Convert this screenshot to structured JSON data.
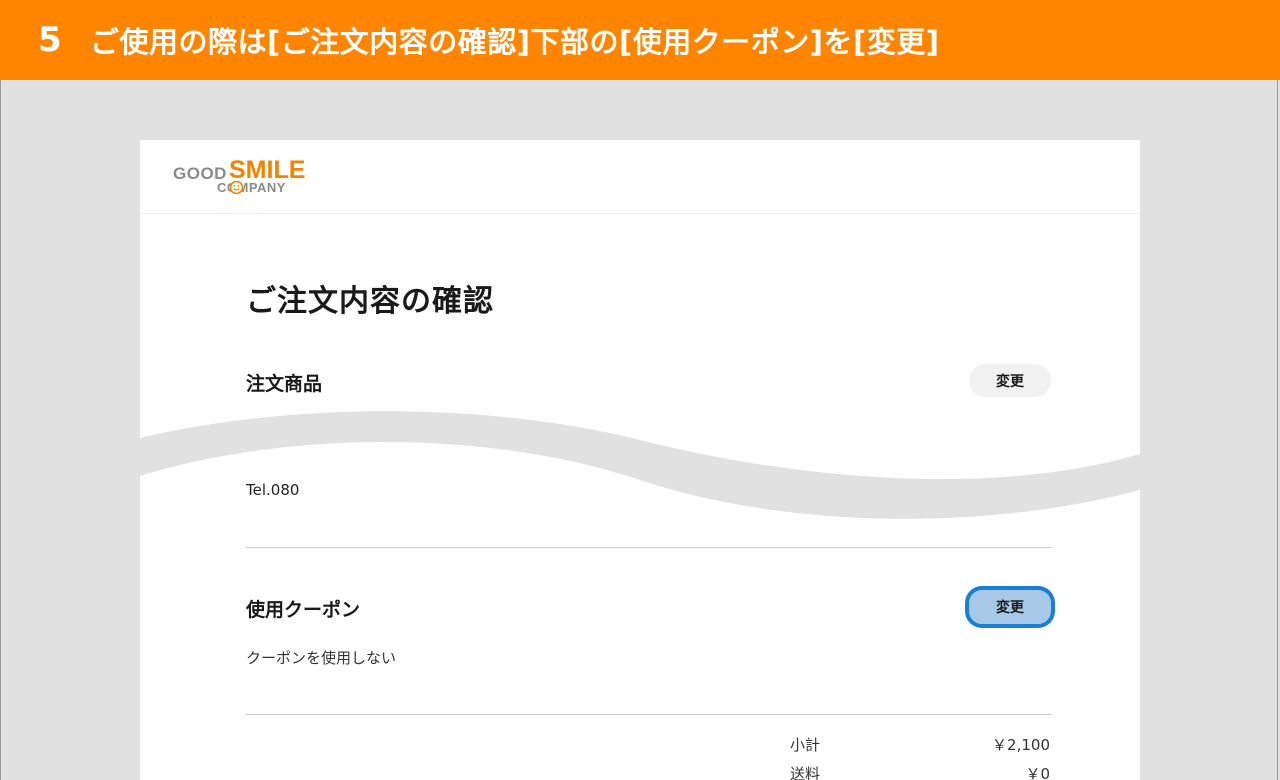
{
  "banner": {
    "step": "5",
    "title": "ご使用の際は[ご注文内容の確認]下部の[使用クーポン]を[変更]"
  },
  "colors": {
    "banner_bg": "#ff8500",
    "page_bg": "#e1e1e2",
    "logo_orange": "#f08300",
    "highlight_border": "#1a7fd4",
    "highlight_fill": "#a8c8e8"
  },
  "logo": {
    "line1a": "GOOD",
    "line1b": "SMILE",
    "line2": "COMPANY",
    "icon": "smiley-icon"
  },
  "page": {
    "title": "ご注文内容の確認"
  },
  "order_items": {
    "title": "注文商品",
    "change_label": "変更"
  },
  "contact": {
    "tel": "Tel.080"
  },
  "coupon": {
    "title": "使用クーポン",
    "change_label": "変更",
    "value": "クーポンを使用しない"
  },
  "summary": {
    "rows": [
      {
        "label": "小計",
        "value": "￥2,100"
      },
      {
        "label": "送料",
        "value": "￥0"
      }
    ]
  }
}
